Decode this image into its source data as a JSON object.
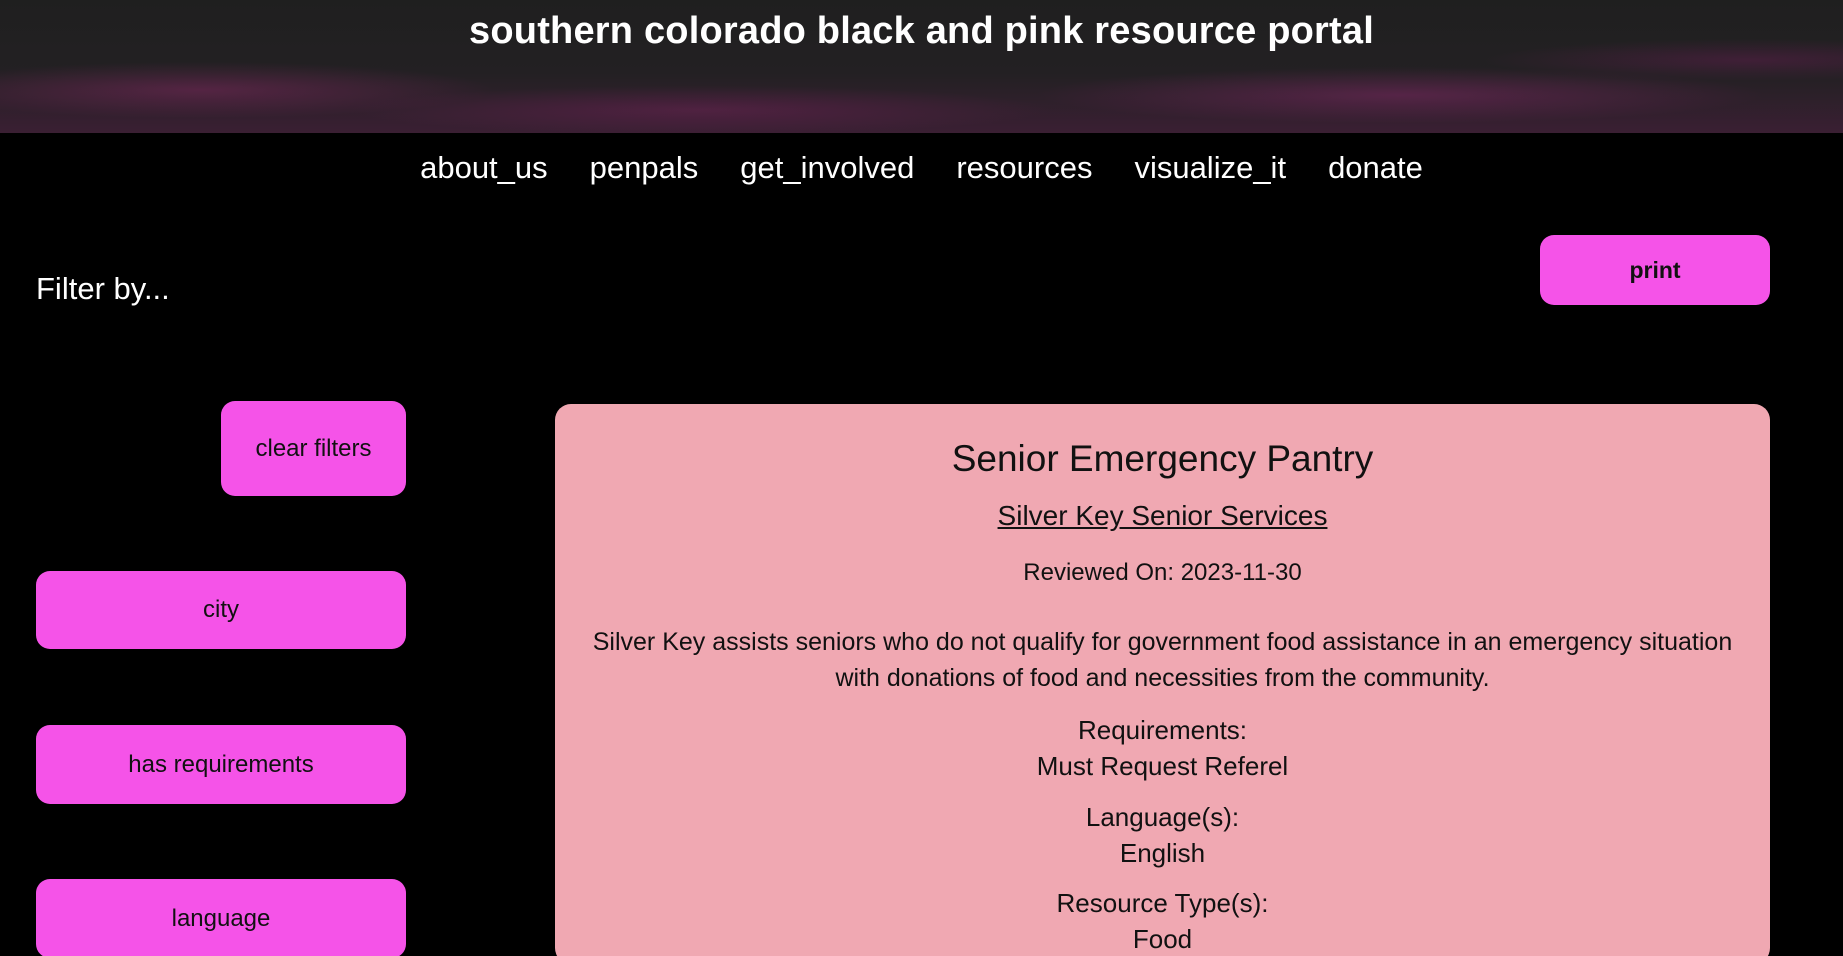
{
  "header": {
    "site_title": "southern colorado black and pink resource portal"
  },
  "nav": {
    "items": [
      {
        "label": "about_us"
      },
      {
        "label": "penpals"
      },
      {
        "label": "get_involved"
      },
      {
        "label": "resources"
      },
      {
        "label": "visualize_it"
      },
      {
        "label": "donate"
      }
    ]
  },
  "toolbar": {
    "print_label": "print"
  },
  "filters": {
    "heading": "Filter by...",
    "clear_label": "clear filters",
    "city_label": "city",
    "requirements_label": "has requirements",
    "language_label": "language"
  },
  "resource": {
    "title": "Senior Emergency Pantry",
    "organization": "Silver Key Senior Services",
    "reviewed": "Reviewed On: 2023-11-30",
    "description": "Silver Key assists seniors who do not qualify for government food assistance in an emergency situation with donations of food and necessities from the community.",
    "requirements_label": "Requirements:",
    "requirements_value": "Must Request Referel",
    "languages_label": "Language(s):",
    "languages_value": "English",
    "types_label": "Resource Type(s):",
    "types_value": "Food"
  },
  "colors": {
    "background": "#000000",
    "accent_button": "#f553e8",
    "card_background": "#f0a8b2"
  }
}
